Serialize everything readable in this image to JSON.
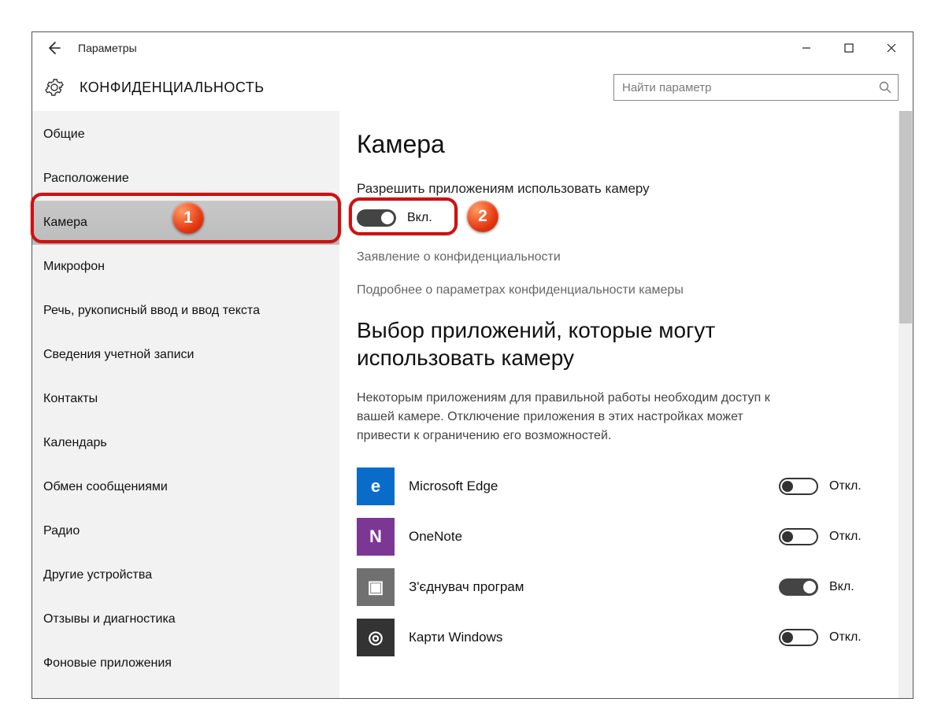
{
  "titlebar": {
    "title": "Параметры"
  },
  "header": {
    "heading": "КОНФИДЕНЦИАЛЬНОСТЬ"
  },
  "search": {
    "placeholder": "Найти параметр"
  },
  "sidebar": {
    "items": [
      {
        "label": "Общие"
      },
      {
        "label": "Расположение"
      },
      {
        "label": "Камера"
      },
      {
        "label": "Микрофон"
      },
      {
        "label": "Речь, рукописный ввод и ввод текста"
      },
      {
        "label": "Сведения учетной записи"
      },
      {
        "label": "Контакты"
      },
      {
        "label": "Календарь"
      },
      {
        "label": "Обмен сообщениями"
      },
      {
        "label": "Радио"
      },
      {
        "label": "Другие устройства"
      },
      {
        "label": "Отзывы и диагностика"
      },
      {
        "label": "Фоновые приложения"
      }
    ]
  },
  "content": {
    "page_title": "Камера",
    "allow_label": "Разрешить приложениям использовать камеру",
    "main_toggle_state": "Вкл.",
    "link_privacy": "Заявление о конфиденциальности",
    "link_details": "Подробнее о параметрах конфиденциальности камеры",
    "apps_heading": "Выбор приложений, которые могут использовать камеру",
    "apps_desc": "Некоторым приложениям для правильной работы необходим доступ к вашей камере. Отключение приложения в этих настройках может привести к ограничению его возможностей.",
    "states": {
      "on": "Вкл.",
      "off": "Откл."
    },
    "apps": [
      {
        "name": "Microsoft Edge",
        "state_key": "off",
        "icon": "edge",
        "glyph": "e"
      },
      {
        "name": "OneNote",
        "state_key": "off",
        "icon": "onenote",
        "glyph": "N"
      },
      {
        "name": "З'єднувач програм",
        "state_key": "on",
        "icon": "connector",
        "glyph": "▣"
      },
      {
        "name": "Карти Windows",
        "state_key": "off",
        "icon": "maps",
        "glyph": "◎"
      }
    ]
  },
  "annotations": {
    "badge1": "1",
    "badge2": "2"
  }
}
